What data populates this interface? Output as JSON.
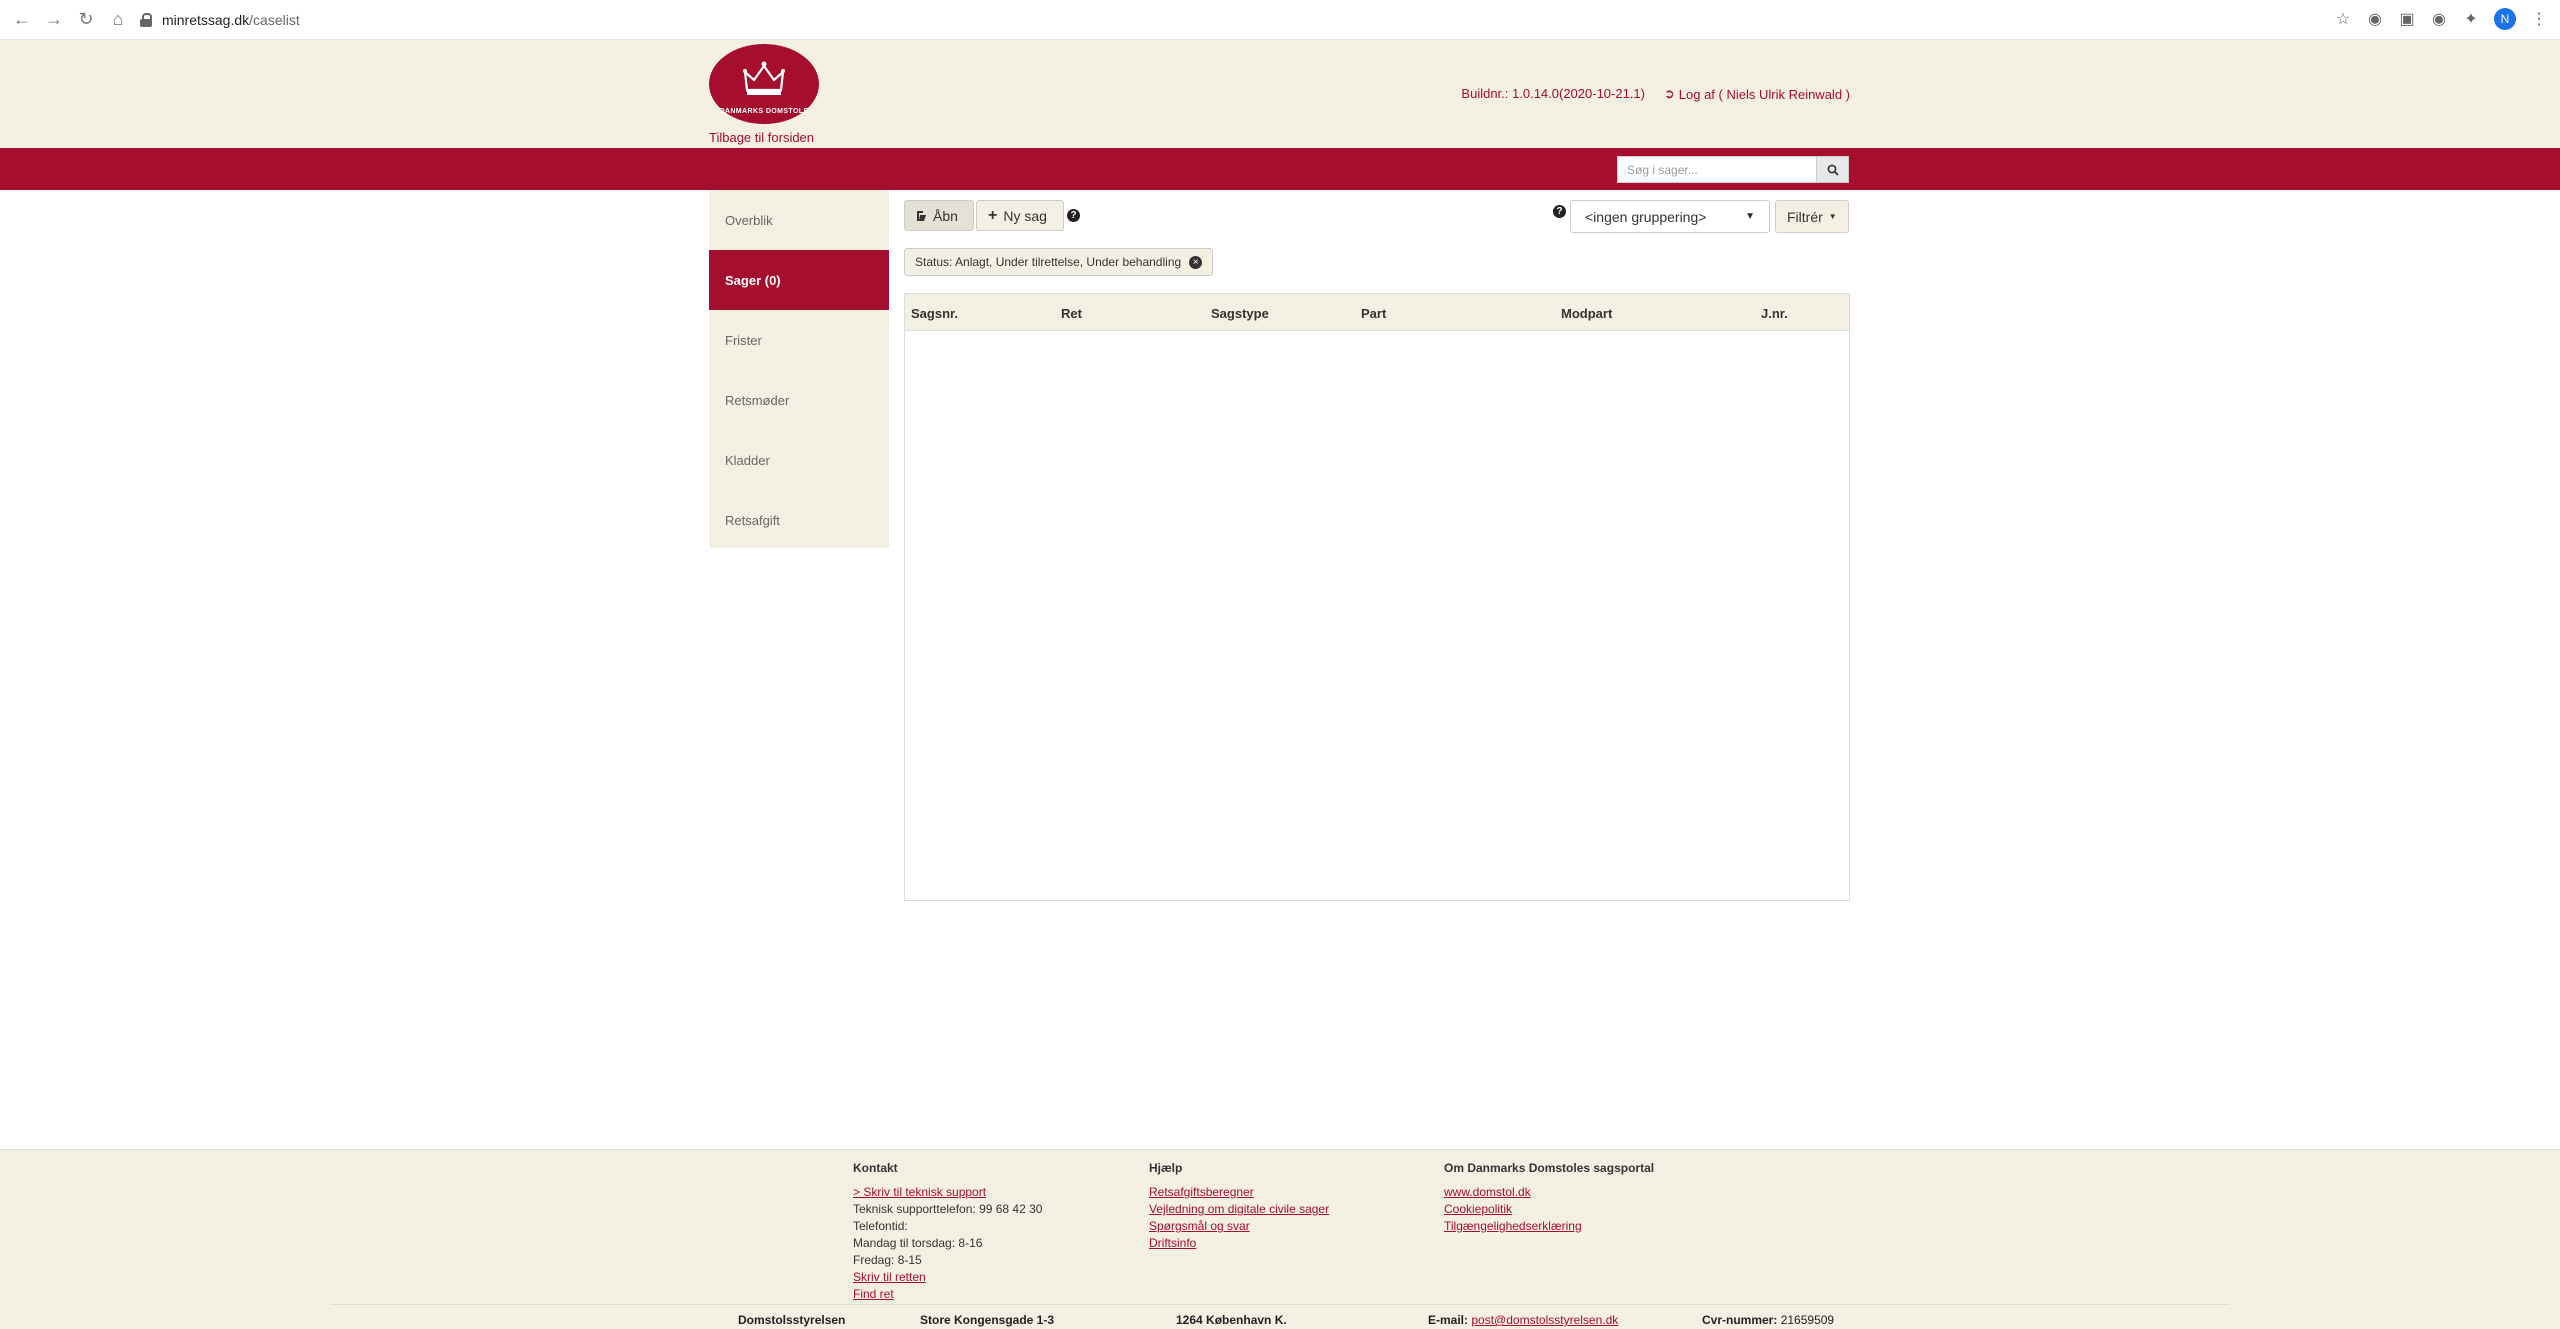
{
  "browser": {
    "url_host": "minretssag.dk",
    "url_path": "/caselist",
    "avatar_letter": "N"
  },
  "header": {
    "logo_text": "DANMARKS DOMSTOLE",
    "back_link": "Tilbage til forsiden",
    "buildnr": "Buildnr.: 1.0.14.0(2020-10-21.1)",
    "logout": "Log af ( Niels Ulrik Reinwald )"
  },
  "search": {
    "placeholder": "Søg i sager..."
  },
  "sidebar": {
    "items": [
      {
        "label": "Overblik"
      },
      {
        "label": "Sager (0)"
      },
      {
        "label": "Frister"
      },
      {
        "label": "Retsmøder"
      },
      {
        "label": "Kladder"
      },
      {
        "label": "Retsafgift"
      }
    ]
  },
  "toolbar": {
    "open_label": "Åbn",
    "new_label": "Ny sag",
    "grouping_value": "<ingen gruppering>",
    "filter_label": "Filtrér"
  },
  "filter_chip": {
    "label": "Status: Anlagt, Under tilrettelse, Under behandling"
  },
  "table": {
    "columns": [
      "Sagsnr.",
      "Ret",
      "Sagstype",
      "Part",
      "Modpart",
      "J.nr."
    ],
    "rows": []
  },
  "footer": {
    "kontakt": {
      "title": "Kontakt",
      "support_link": "> Skriv til teknisk support",
      "phone": "Teknisk supporttelefon: 99 68 42 30",
      "hours_label": "Telefontid:",
      "hours_weekday": "Mandag til torsdag: 8-16",
      "hours_friday": "Fredag: 8-15",
      "write_court": "Skriv til retten",
      "find_court": "Find ret"
    },
    "hjaelp": {
      "title": "Hjælp",
      "links": [
        "Retsafgiftsberegner",
        "Vejledning om digitale civile sager",
        "Spørgsmål og svar",
        "Driftsinfo"
      ]
    },
    "om": {
      "title": "Om Danmarks Domstoles sagsportal",
      "links": [
        "www.domstol.dk",
        "Cookiepolitik",
        "Tilgængelighedserklæring"
      ]
    },
    "bottom": {
      "org": "Domstolsstyrelsen",
      "street": "Store Kongensgade 1-3",
      "city": "1264 København K.",
      "email_label": "E-mail:",
      "email": "post@domstolsstyrelsen.dk",
      "cvr_label": "Cvr-nummer:",
      "cvr": "21659509"
    }
  },
  "colors": {
    "brand_red": "#a50e2d",
    "beige": "#f3efe2"
  }
}
